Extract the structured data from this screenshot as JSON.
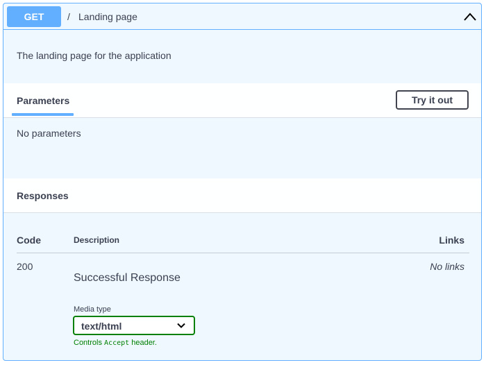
{
  "operation": {
    "method": "GET",
    "path_separator": "/",
    "path_summary": "Landing page",
    "description": "The landing page for the application"
  },
  "parameters": {
    "title": "Parameters",
    "try_button_label": "Try it out",
    "empty_message": "No parameters"
  },
  "responses": {
    "title": "Responses",
    "columns": {
      "code": "Code",
      "description": "Description",
      "links": "Links"
    },
    "rows": [
      {
        "code": "200",
        "description": "Successful Response",
        "links": "No links",
        "media_type_label": "Media type",
        "media_type_value": "text/html",
        "media_help_prefix": "Controls",
        "media_help_code": "Accept",
        "media_help_suffix": "header."
      }
    ]
  },
  "colors": {
    "accent": "#61affe",
    "block_background": "#eff7ff",
    "success": "#008000",
    "text": "#3b4151"
  },
  "icons": {
    "collapse": "chevron-up-icon",
    "select": "chevron-down-icon"
  }
}
